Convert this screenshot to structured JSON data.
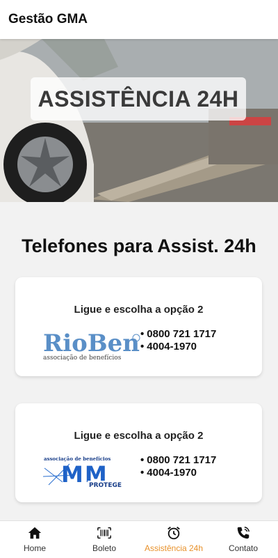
{
  "appbar": {
    "title": "Gestão GMA"
  },
  "hero": {
    "banner_text": "ASSISTÊNCIA 24H"
  },
  "section": {
    "title": "Telefones para Assist. 24h"
  },
  "cards": [
    {
      "instruction": "Ligue e escolha a opção 2",
      "logo": {
        "name": "RioBen",
        "tagline": "associação de benefícios"
      },
      "phones": [
        "0800 721 1717",
        "4004-1970"
      ]
    },
    {
      "instruction": "Ligue e escolha a opção 2",
      "logo": {
        "name": "MM",
        "top_text": "associação de benefícios",
        "badge": "PROTEGE"
      },
      "phones": [
        "0800 721 1717",
        "4004-1970"
      ]
    }
  ],
  "bottom_nav": {
    "items": [
      {
        "label": "Home",
        "icon": "home-icon"
      },
      {
        "label": "Boleto",
        "icon": "barcode-icon"
      },
      {
        "label": "Assistência 24h",
        "icon": "alarm-clock-icon",
        "active": true
      },
      {
        "label": "Contato",
        "icon": "phone-icon"
      }
    ]
  },
  "colors": {
    "active": "#e8912a",
    "inactive": "#333333"
  }
}
